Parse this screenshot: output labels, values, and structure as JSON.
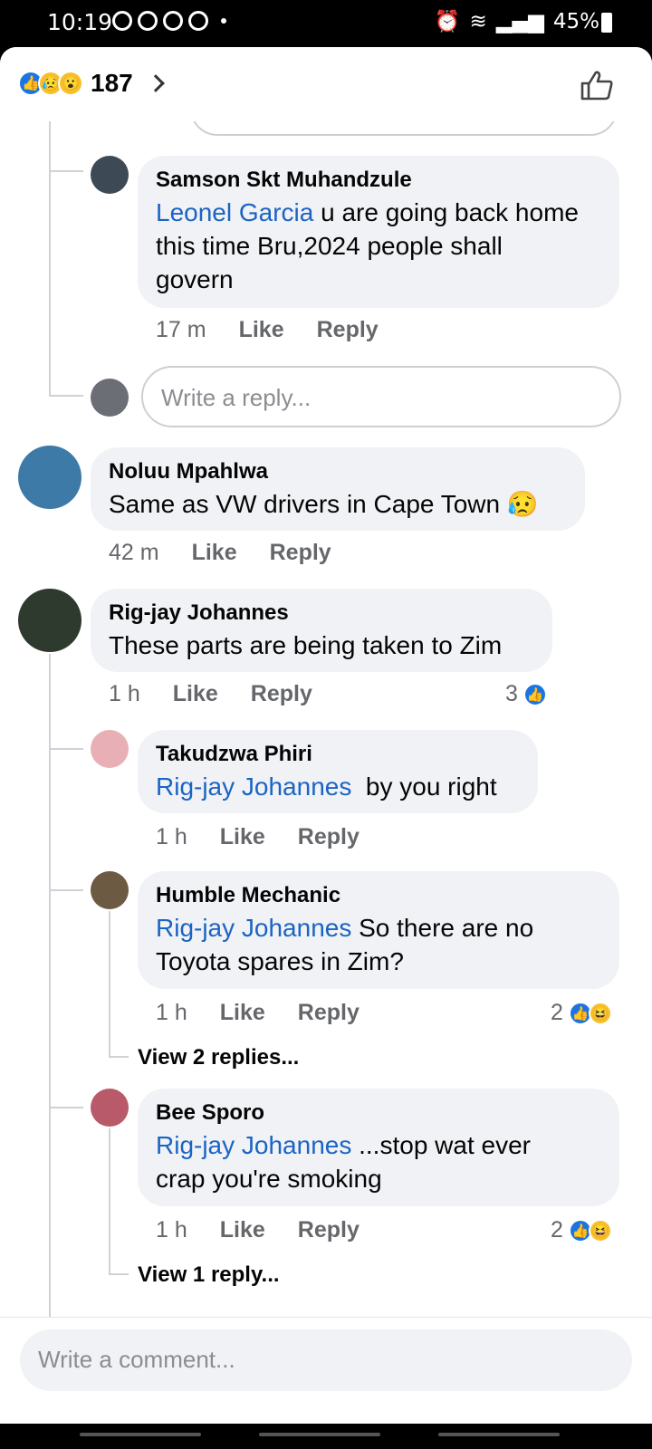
{
  "status": {
    "time": "10:19",
    "battery": "45%"
  },
  "reactions": {
    "count": "187",
    "types": [
      "like-icon",
      "sad-icon",
      "wow-icon"
    ]
  },
  "comments": [
    {
      "name": "Samson Skt Muhandzule",
      "mention": "Leonel Garcia",
      "text_lines": [
        " u are going back home",
        "this time Bru,2024 people shall",
        "govern"
      ],
      "time": "17 m",
      "like": "Like",
      "reply": "Reply"
    },
    {
      "name": "Noluu Mpahlwa",
      "text": "Same as VW drivers in Cape Town 😥",
      "time": "42 m",
      "like": "Like",
      "reply": "Reply"
    },
    {
      "name": "Rig-jay Johannes",
      "text": "These parts are being taken to Zim",
      "time": "1 h",
      "like": "Like",
      "reply": "Reply",
      "reaction_count": "3"
    },
    {
      "name": "Takudzwa Phiri",
      "mention": "Rig-jay Johannes",
      "text": "  by you right",
      "time": "1 h",
      "like": "Like",
      "reply": "Reply"
    },
    {
      "name": "Humble Mechanic",
      "mention": "Rig-jay Johannes",
      "text_lines": [
        " So there are no",
        "Toyota spares in Zim?"
      ],
      "time": "1 h",
      "like": "Like",
      "reply": "Reply",
      "reaction_count": "2",
      "view_replies": "View 2 replies..."
    },
    {
      "name": "Bee Sporo",
      "mention": "Rig-jay Johannes",
      "text_lines": [
        " ...stop wat ever",
        "crap you're smoking"
      ],
      "time": "1 h",
      "like": "Like",
      "reply": "Reply",
      "reaction_count": "2",
      "view_replies": "View 1 reply..."
    }
  ],
  "reply_placeholder": "Write a reply...",
  "comment_placeholder": "Write a comment..."
}
